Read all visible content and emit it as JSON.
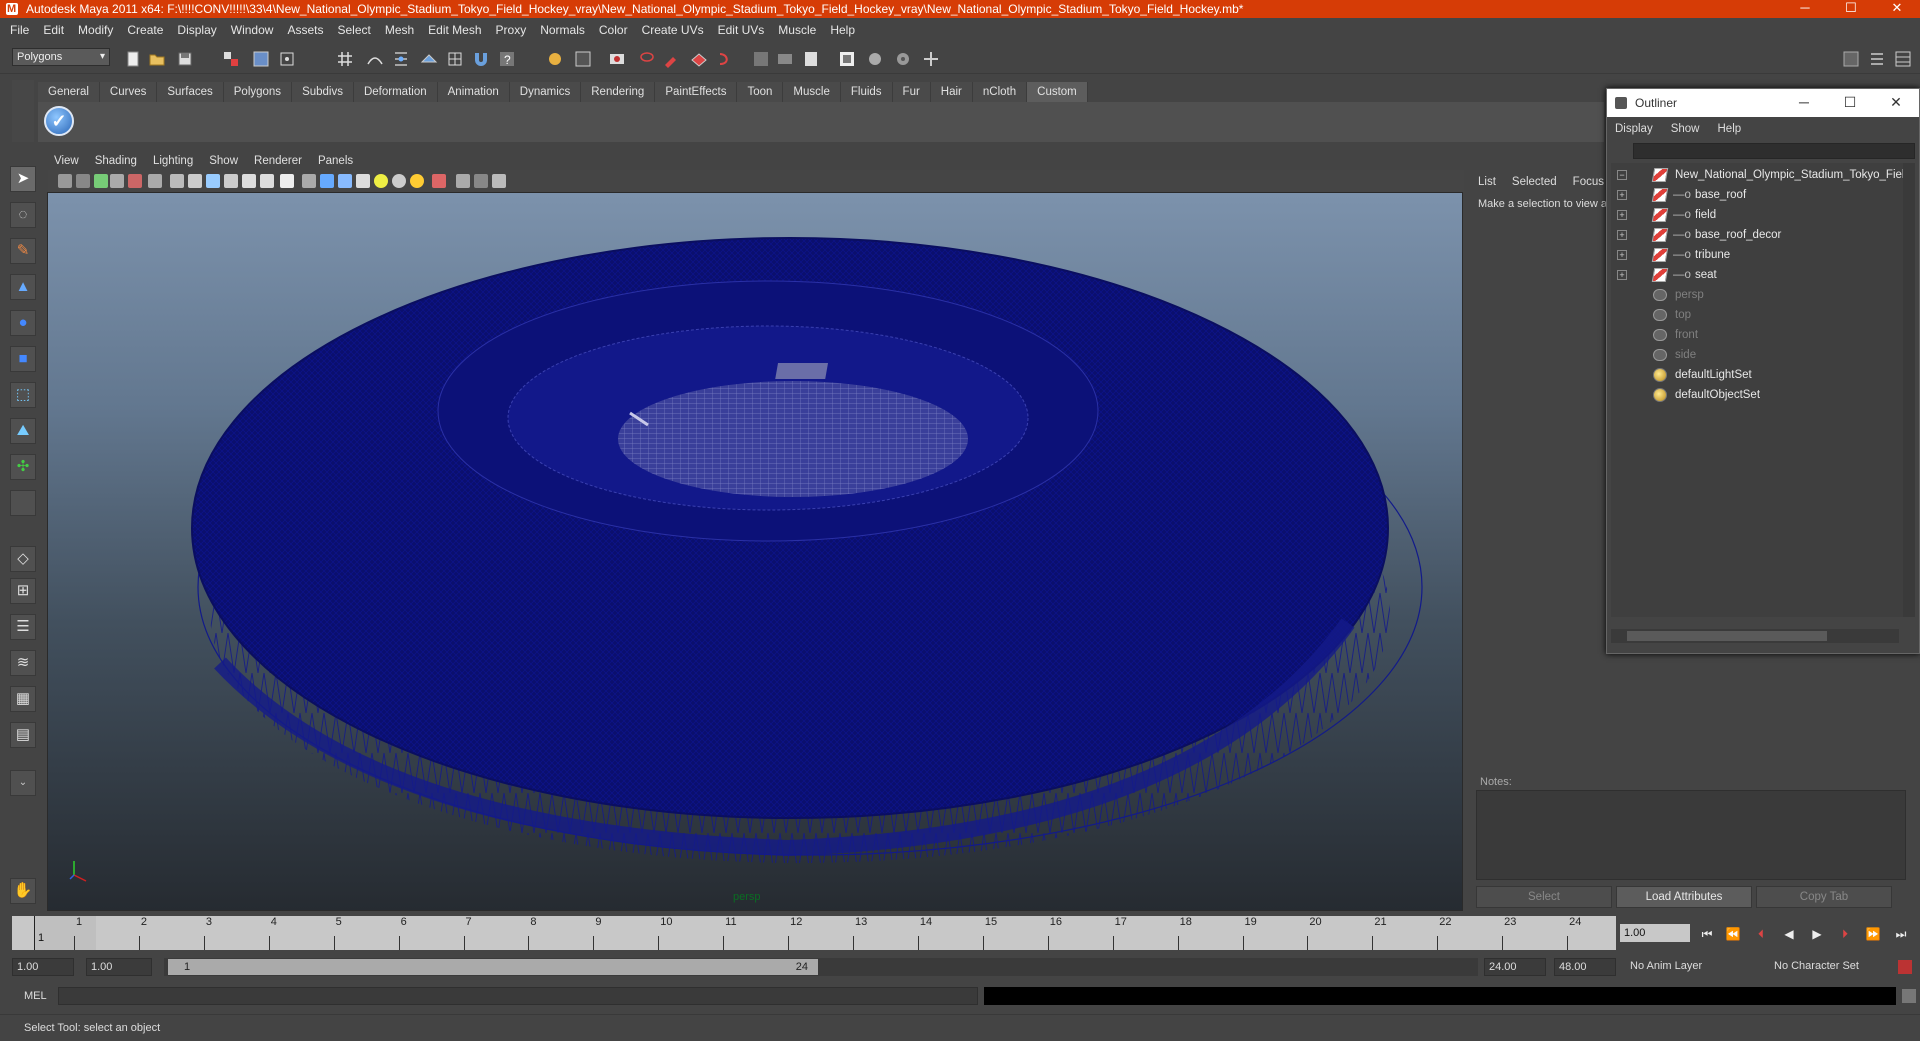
{
  "window": {
    "title": "Autodesk Maya 2011 x64: F:\\!!!!CONV!!!!!\\33\\4\\New_National_Olympic_Stadium_Tokyo_Field_Hockey_vray\\New_National_Olympic_Stadium_Tokyo_Field_Hockey_vray\\New_National_Olympic_Stadium_Tokyo_Field_Hockey.mb*",
    "minimize": "─",
    "maximize": "☐",
    "close": "✕"
  },
  "menubar": [
    "File",
    "Edit",
    "Modify",
    "Create",
    "Display",
    "Window",
    "Assets",
    "Select",
    "Mesh",
    "Edit Mesh",
    "Proxy",
    "Normals",
    "Color",
    "Create UVs",
    "Edit UVs",
    "Muscle",
    "Help"
  ],
  "statusline": {
    "mode": "Polygons"
  },
  "shelf": {
    "tabs": [
      "General",
      "Curves",
      "Surfaces",
      "Polygons",
      "Subdivs",
      "Deformation",
      "Animation",
      "Dynamics",
      "Rendering",
      "PaintEffects",
      "Toon",
      "Muscle",
      "Fluids",
      "Fur",
      "Hair",
      "nCloth",
      "Custom"
    ],
    "active_tab": "Custom"
  },
  "viewport": {
    "menu": [
      "View",
      "Shading",
      "Lighting",
      "Show",
      "Renderer",
      "Panels"
    ],
    "camera_label": "persp",
    "wire_color": "#0b0f6e"
  },
  "attribute_editor": {
    "tabs": [
      "List",
      "Selected",
      "Focus"
    ],
    "message": "Make a selection to view at",
    "notes_label": "Notes:",
    "buttons": {
      "select": "Select",
      "load": "Load Attributes",
      "copy": "Copy Tab"
    }
  },
  "outliner": {
    "title": "Outliner",
    "menu": [
      "Display",
      "Show",
      "Help"
    ],
    "items": [
      {
        "label": "New_National_Olympic_Stadium_Tokyo_Field",
        "type": "mesh",
        "expander": "−",
        "indent": 0,
        "dim": false
      },
      {
        "label": "base_roof",
        "type": "mesh",
        "expander": "+",
        "indent": 1,
        "dim": false
      },
      {
        "label": "field",
        "type": "mesh",
        "expander": "+",
        "indent": 1,
        "dim": false
      },
      {
        "label": "base_roof_decor",
        "type": "mesh",
        "expander": "+",
        "indent": 1,
        "dim": false
      },
      {
        "label": "tribune",
        "type": "mesh",
        "expander": "+",
        "indent": 1,
        "dim": false
      },
      {
        "label": "seat",
        "type": "mesh",
        "expander": "+",
        "indent": 1,
        "dim": false
      },
      {
        "label": "persp",
        "type": "camera",
        "expander": "",
        "indent": 0,
        "dim": true
      },
      {
        "label": "top",
        "type": "camera",
        "expander": "",
        "indent": 0,
        "dim": true
      },
      {
        "label": "front",
        "type": "camera",
        "expander": "",
        "indent": 0,
        "dim": true
      },
      {
        "label": "side",
        "type": "camera",
        "expander": "",
        "indent": 0,
        "dim": true
      },
      {
        "label": "defaultLightSet",
        "type": "set",
        "expander": "",
        "indent": 0,
        "dim": false
      },
      {
        "label": "defaultObjectSet",
        "type": "set",
        "expander": "",
        "indent": 0,
        "dim": false
      }
    ]
  },
  "timeline": {
    "frames": [
      "1",
      "2",
      "3",
      "4",
      "5",
      "6",
      "7",
      "8",
      "9",
      "10",
      "11",
      "12",
      "13",
      "14",
      "15",
      "16",
      "17",
      "18",
      "19",
      "20",
      "21",
      "22",
      "23",
      "24"
    ],
    "current_marker": "1",
    "current_frame": "1.00"
  },
  "range": {
    "start": "1.00",
    "playback_start": "1.00",
    "slider_start": "1",
    "slider_end": "24",
    "playback_end": "24.00",
    "end": "48.00",
    "anim_layer": "No Anim Layer",
    "character_set": "No Character Set"
  },
  "command": {
    "label": "MEL"
  },
  "helpline": "Select Tool: select an object"
}
